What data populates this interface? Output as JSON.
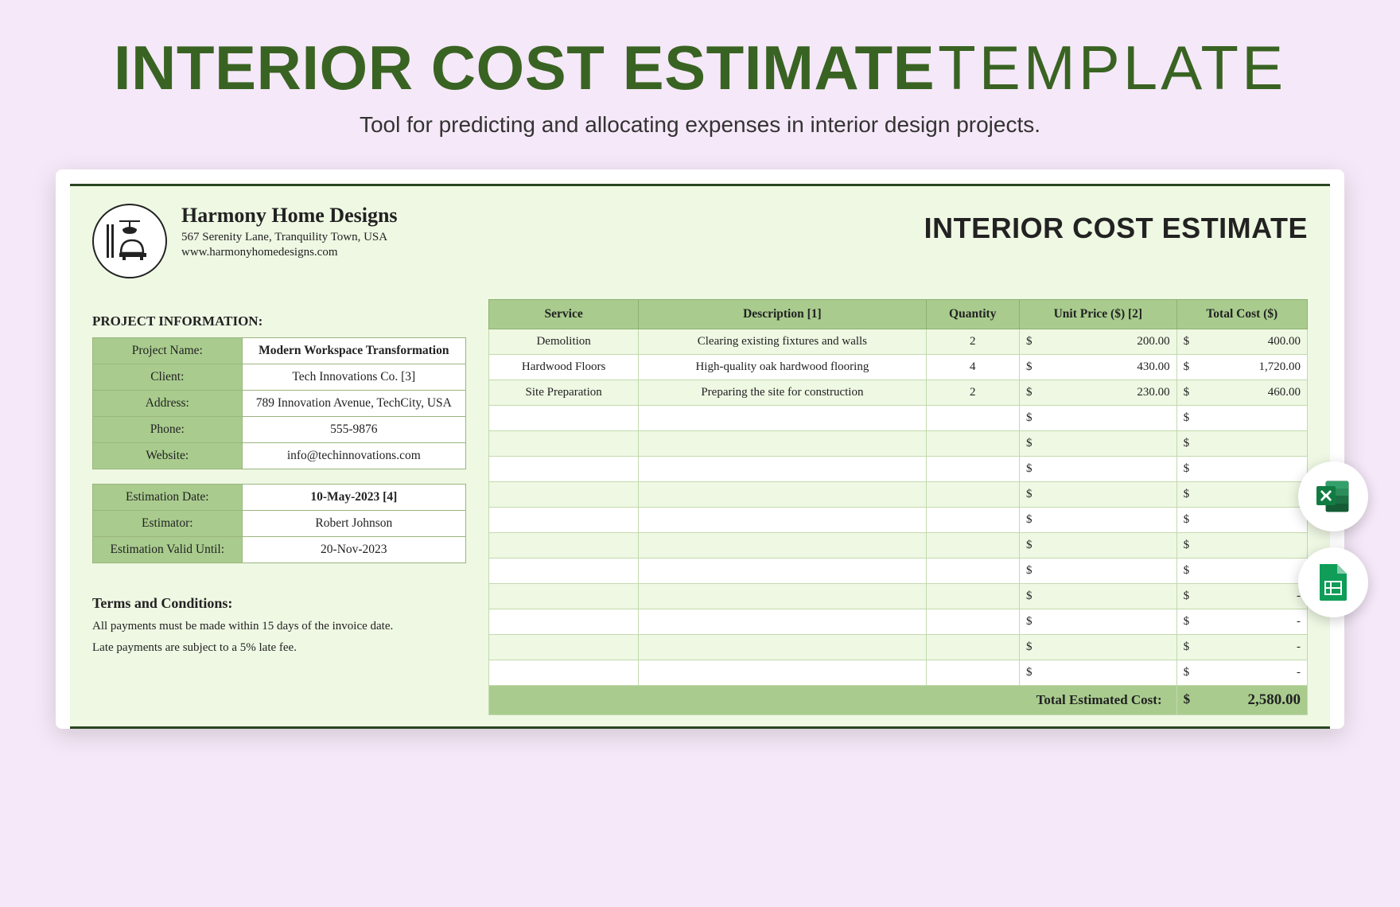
{
  "title": {
    "bold": "INTERIOR COST ESTIMATE",
    "thin": "TEMPLATE"
  },
  "subtitle": "Tool for predicting and allocating expenses in interior design projects.",
  "company": {
    "name": "Harmony Home Designs",
    "address": "567 Serenity Lane, Tranquility Town, USA",
    "website": "www.harmonyhomedesigns.com"
  },
  "docTitle": "INTERIOR COST ESTIMATE",
  "projectInfoLabel": "PROJECT INFORMATION:",
  "projectInfo": [
    {
      "label": "Project Name:",
      "value": "Modern Workspace Transformation"
    },
    {
      "label": "Client:",
      "value": "Tech Innovations Co. [3]"
    },
    {
      "label": "Address:",
      "value": "789 Innovation Avenue, TechCity, USA"
    },
    {
      "label": "Phone:",
      "value": "555-9876"
    },
    {
      "label": "Website:",
      "value": "info@techinnovations.com"
    }
  ],
  "estimation": [
    {
      "label": "Estimation Date:",
      "value": "10-May-2023 [4]"
    },
    {
      "label": "Estimator:",
      "value": "Robert Johnson"
    },
    {
      "label": "Estimation Valid Until:",
      "value": "20-Nov-2023"
    }
  ],
  "terms": {
    "title": "Terms and Conditions:",
    "lines": [
      "All payments must be made within 15 days of the invoice date.",
      "Late payments are subject to a 5% late fee."
    ]
  },
  "costHeaders": [
    "Service",
    "Description [1]",
    "Quantity",
    "Unit Price ($) [2]",
    "Total Cost ($)"
  ],
  "costRows": [
    {
      "service": "Demolition",
      "desc": "Clearing existing fixtures and walls",
      "qty": "2",
      "unit": "200.00",
      "total": "400.00"
    },
    {
      "service": "Hardwood Floors",
      "desc": "High-quality oak hardwood flooring",
      "qty": "4",
      "unit": "430.00",
      "total": "1,720.00"
    },
    {
      "service": "Site Preparation",
      "desc": "Preparing the site for construction",
      "qty": "2",
      "unit": "230.00",
      "total": "460.00"
    },
    {
      "service": "",
      "desc": "",
      "qty": "",
      "unit": "",
      "total": ""
    },
    {
      "service": "",
      "desc": "",
      "qty": "",
      "unit": "",
      "total": ""
    },
    {
      "service": "",
      "desc": "",
      "qty": "",
      "unit": "",
      "total": ""
    },
    {
      "service": "",
      "desc": "",
      "qty": "",
      "unit": "",
      "total": ""
    },
    {
      "service": "",
      "desc": "",
      "qty": "",
      "unit": "",
      "total": ""
    },
    {
      "service": "",
      "desc": "",
      "qty": "",
      "unit": "",
      "total": ""
    },
    {
      "service": "",
      "desc": "",
      "qty": "",
      "unit": "",
      "total": ""
    },
    {
      "service": "",
      "desc": "",
      "qty": "",
      "unit": "",
      "total": "-"
    },
    {
      "service": "",
      "desc": "",
      "qty": "",
      "unit": "",
      "total": "-"
    },
    {
      "service": "",
      "desc": "",
      "qty": "",
      "unit": "",
      "total": "-"
    },
    {
      "service": "",
      "desc": "",
      "qty": "",
      "unit": "",
      "total": "-"
    }
  ],
  "totalLabel": "Total Estimated Cost:",
  "totalValue": "2,580.00"
}
